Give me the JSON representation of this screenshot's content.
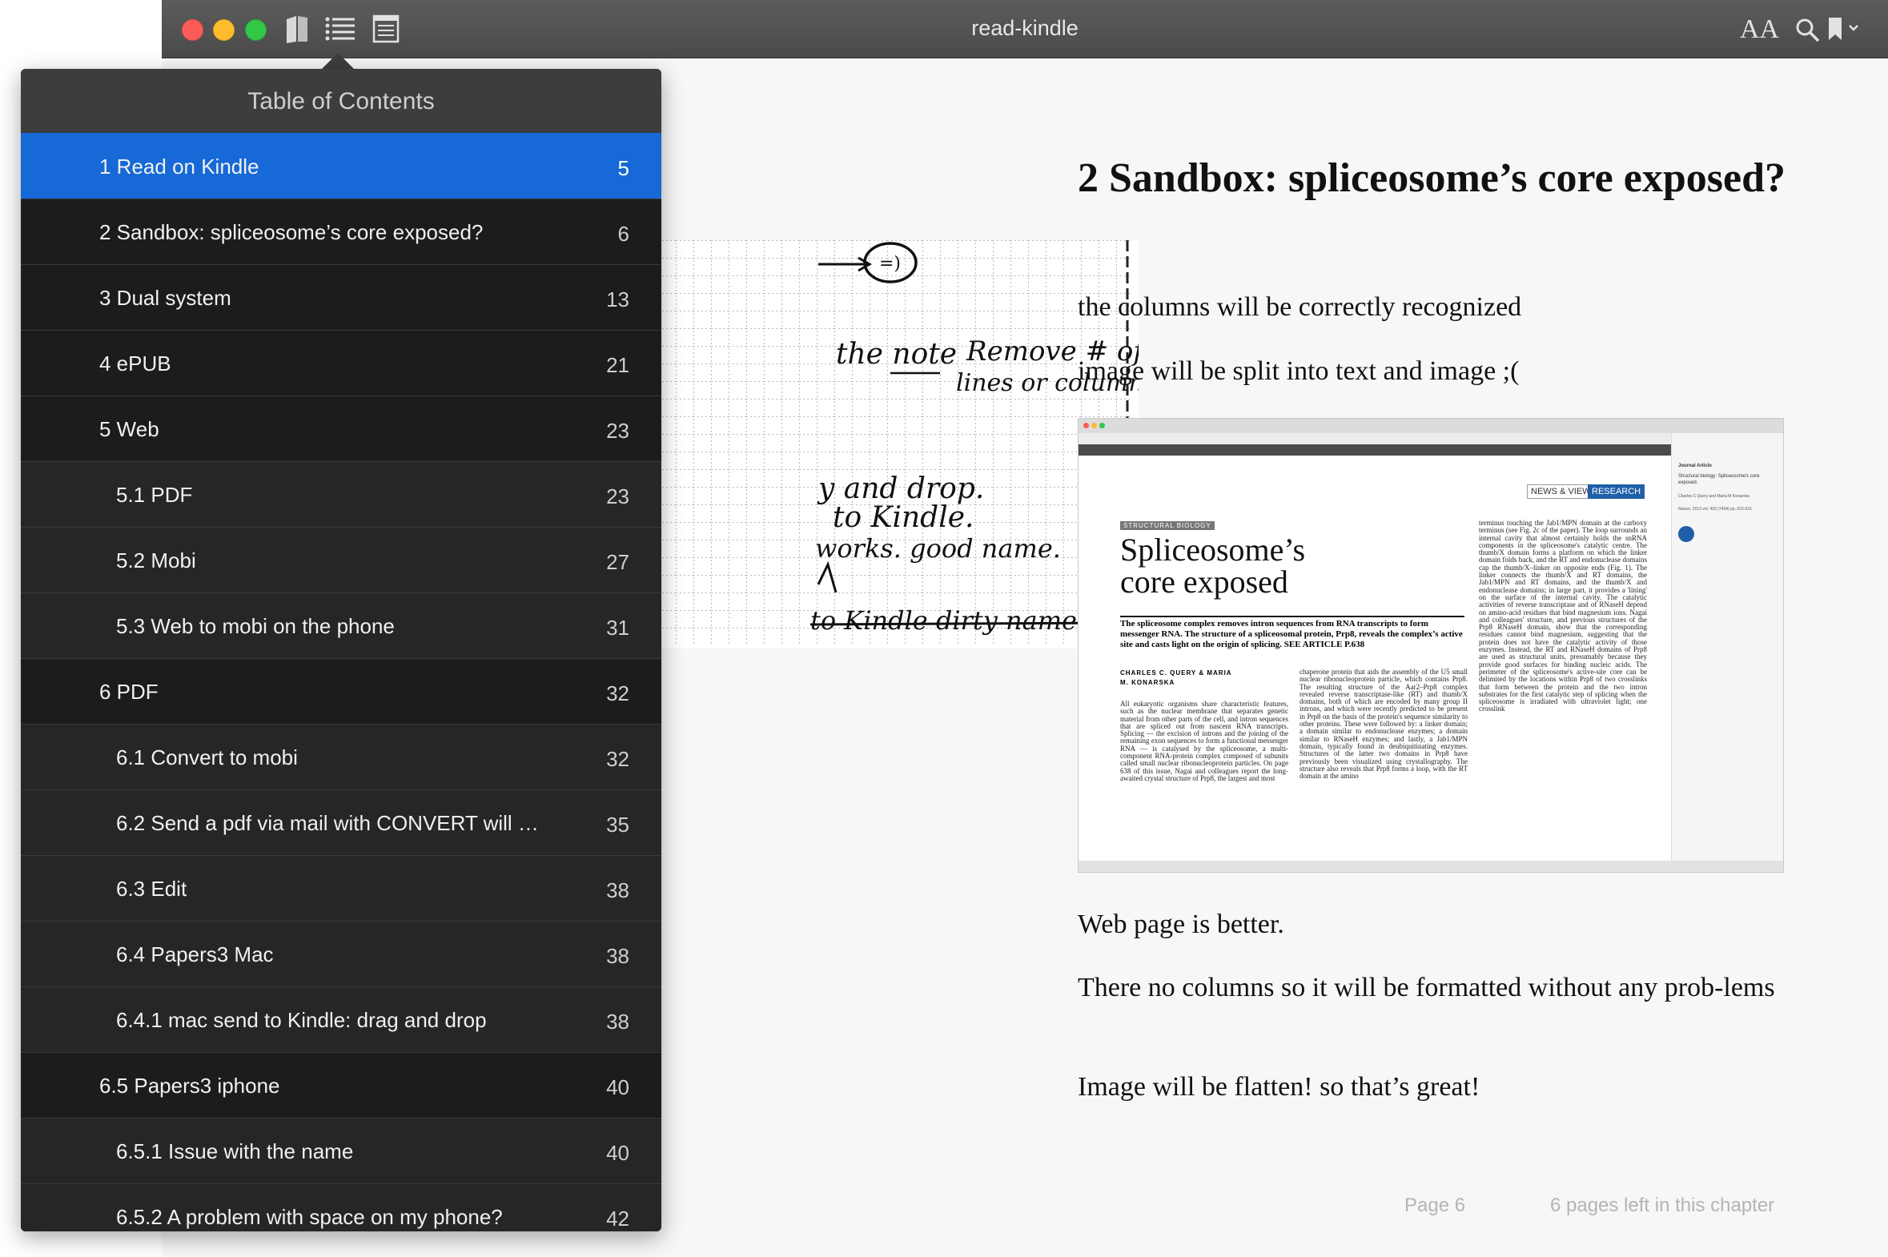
{
  "window": {
    "title": "read-kindle",
    "font_size_label": "AA"
  },
  "toc": {
    "title": "Table of Contents",
    "items": [
      {
        "label": "1 Read on Kindle",
        "page": "5",
        "active": true,
        "sub": false
      },
      {
        "label": "2 Sandbox: spliceosome’s core exposed?",
        "page": "6",
        "active": false,
        "sub": false
      },
      {
        "label": "3 Dual system",
        "page": "13",
        "active": false,
        "sub": false
      },
      {
        "label": "4 ePUB",
        "page": "21",
        "active": false,
        "sub": false
      },
      {
        "label": "5 Web",
        "page": "23",
        "active": false,
        "sub": false
      },
      {
        "label": "5.1 PDF",
        "page": "23",
        "active": false,
        "sub": true
      },
      {
        "label": "5.2 Mobi",
        "page": "27",
        "active": false,
        "sub": true
      },
      {
        "label": "5.3 Web to mobi on the phone",
        "page": "31",
        "active": false,
        "sub": true
      },
      {
        "label": "6 PDF",
        "page": "32",
        "active": false,
        "sub": false
      },
      {
        "label": "6.1 Convert to mobi",
        "page": "32",
        "active": false,
        "sub": true
      },
      {
        "label": "6.2 Send a pdf via mail with CONVERT will …",
        "page": "35",
        "active": false,
        "sub": true
      },
      {
        "label": "6.3 Edit",
        "page": "38",
        "active": false,
        "sub": true
      },
      {
        "label": "6.4 Papers3 Mac",
        "page": "38",
        "active": false,
        "sub": true
      },
      {
        "label": "6.4.1 mac send to Kindle: drag and drop",
        "page": "38",
        "active": false,
        "sub": true
      },
      {
        "label": "6.5 Papers3 iphone",
        "page": "40",
        "active": false,
        "sub": false
      },
      {
        "label": "6.5.1 Issue with the name",
        "page": "40",
        "active": false,
        "sub": true
      },
      {
        "label": "6.5.2 A problem with space on my phone?",
        "page": "42",
        "active": false,
        "sub": true
      }
    ]
  },
  "content": {
    "chapter_title": "2 Sandbox: spliceosome’s core exposed?",
    "p1": "the columns will be correctly recognized",
    "p2": "image will be split into text and image ;(",
    "p3": "Web page is better.",
    "p4": "There no columns so it will be formatted without any prob-lems",
    "p5": "Image will be flatten! so that’s great!"
  },
  "sketch": {
    "line1": "the note",
    "line2": "Remove # of",
    "line3": "lines or columns.",
    "line4": "y and drop.",
    "line5": "to Kindle.",
    "line6": "works. good name.",
    "line7": "to Kindle dirty name!"
  },
  "embedded_article": {
    "news_views": "NEWS & VIEWS",
    "research": "RESEARCH",
    "section": "STRUCTURAL BIOLOGY",
    "headline": "Spliceosome’s core exposed",
    "standfirst": "The spliceosome complex removes intron sequences from RNA transcripts to form messenger RNA. The structure of a spliceosomal protein, Prp8, reveals the complex’s active site and casts light on the origin of splicing. SEE ARTICLE P.638",
    "authors": "CHARLES C. QUERY & MARIA M. KONARSKA",
    "col1": "All eukaryotic organisms share characteristic features, such as the nuclear membrane that separates genetic material from other parts of the cell, and intron sequences that are spliced out from nascent RNA transcripts. Splicing — the excision of introns and the joining of the remaining exon sequences to form a functional messenger RNA — is catalysed by the spliceosome, a multi-component RNA-protein complex composed of subunits called small nuclear ribonucleoprotein particles. On page 638 of this issue, Nagai and colleagues report the long-awaited crystal structure of Prp8, the largest and most",
    "col2": "chaperone protein that aids the assembly of the U5 small nuclear ribonucleoprotein particle, which contains Prp8. The resulting structure of the Aar2–Prp8 complex revealed reverse transcriptase-like (RT) and thumb/X domains, both of which are encoded by many group II introns, and which were recently predicted to be present in Prp8 on the basis of the protein's sequence similarity to other proteins. These were followed by: a linker domain; a domain similar to endonuclease enzymes; a domain similar to RNaseH enzymes; and lastly, a Jab1/MPN domain, typically found in deubiquitinating enzymes. Structures of the latter two domains in Prp8 have previously been visualized using crystallography. The structure also reveals that Prp8 forms a loop, with the RT domain at the amino",
    "col3": "terminus touching the Jab1/MPN domain at the carboxy terminus (see Fig. 2c of the paper). The loop surrounds an internal cavity that almost certainly holds the snRNA components in the spliceosome's catalytic centre. The thumb/X domain forms a platform on which the linker domain folds back, and the RT and endonuclease domains cap the thumb/X–linker on opposite ends (Fig. 1). The linker connects the thumb/X and RT domains, the Jab1/MPN and RT domains, and the thumb/X and endonuclease domains; in large part, it provides a 'lining' on the surface of the internal cavity. The catalytic activities of reverse transcriptase and of RNaseH depend on amino-acid residues that bind magnesium ions. Nagai and colleagues' structure, and previous structures of the Prp8 RNaseH domain, show that the corresponding residues cannot bind magnesium, suggesting that the protein does not have the catalytic activity of those enzymes. Instead, the RT and RNaseH domains of Prp8 are used as structural units, presumably because they provide good surfaces for binding nucleic acids. The perimeter of the spliceosome's active-site core can be delimited by the locations within Prp8 of two crosslinks that form between the protein and the two intron substrates for the first catalytic step of splicing when the spliceosome is irradiated with ultraviolet light; one crosslink",
    "side_type": "Journal Article",
    "side_title": "Structural biology: Spliceosome's core exposed.",
    "side_authors": "Charles C Query and Maria M Konarska",
    "side_ref": "Nature, 2013 vol. 493 (7434) pp. 615-616"
  },
  "footer": {
    "page": "Page 6",
    "left": "6 pages left in this chapter"
  }
}
